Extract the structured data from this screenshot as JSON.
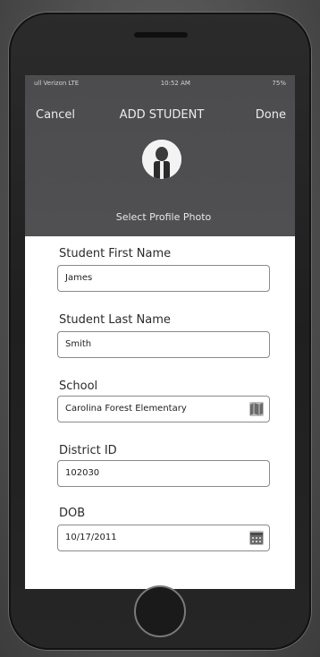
{
  "status_bar": {
    "carrier": "ull Verizon LTE",
    "time": "10:52 AM",
    "battery": "75%"
  },
  "nav": {
    "cancel": "Cancel",
    "title": "ADD STUDENT",
    "done": "Done"
  },
  "profile": {
    "select_photo": "Select Profile Photo"
  },
  "form": {
    "first_name_label": "Student First Name",
    "first_name_value": "James",
    "last_name_label": "Student Last Name",
    "last_name_value": "Smith",
    "school_label": "School",
    "school_value": "Carolina Forest Elementary",
    "district_label": "District ID",
    "district_value": "102030",
    "dob_label": "DOB",
    "dob_value": "10/17/2011"
  },
  "icons": {
    "school_field": "map-icon",
    "dob_field": "calendar-icon"
  }
}
